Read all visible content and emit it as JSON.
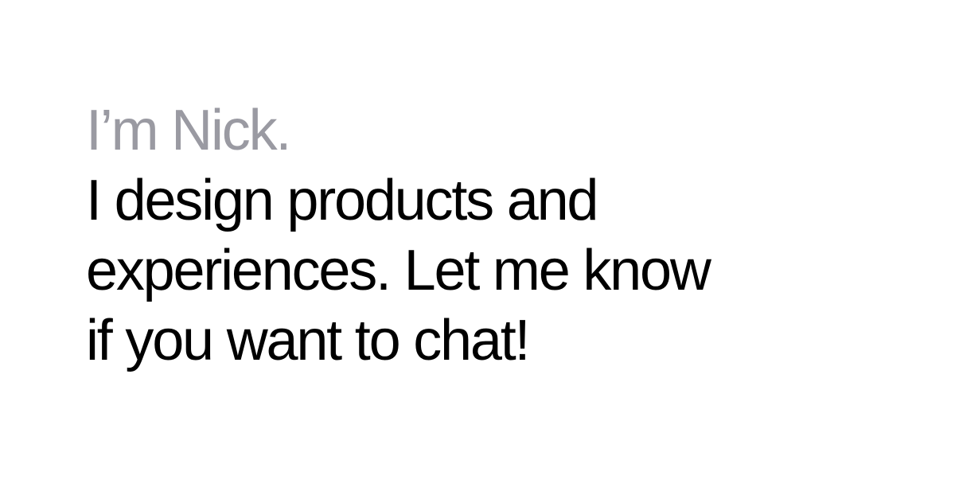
{
  "hero": {
    "greeting": "I’m Nick.",
    "tagline_lines": [
      "I design products and",
      "experiences. Let me know",
      "if you want to chat!"
    ]
  },
  "colors": {
    "background": "#ffffff",
    "greeting_text": "#9a9aa2",
    "tagline_text": "#000000"
  }
}
